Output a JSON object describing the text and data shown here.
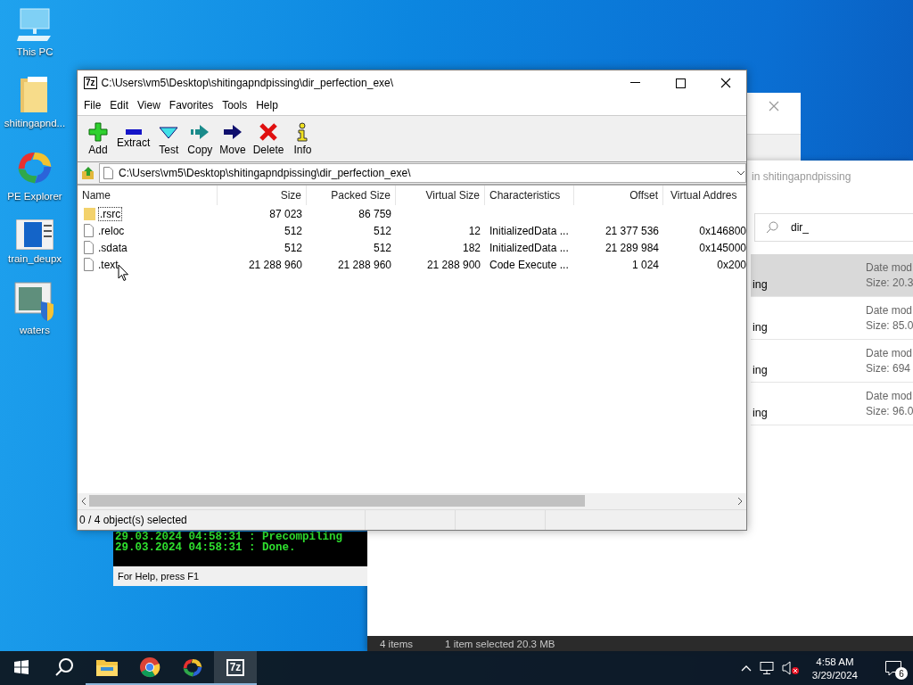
{
  "desktop_icons": [
    {
      "label": "This PC",
      "kind": "pc"
    },
    {
      "label": "shitingapnd...",
      "kind": "folder"
    },
    {
      "label": "PE Explorer",
      "kind": "pe"
    },
    {
      "label": "train_deupx",
      "kind": "window"
    },
    {
      "label": "waters",
      "kind": "installer"
    }
  ],
  "explorer_window": {
    "location": "in shitingapndpissing",
    "search_value": "dir_",
    "results": [
      {
        "name": "ing",
        "date": "Date mod",
        "size": "Size: 20.3",
        "selected": true
      },
      {
        "name": "ing",
        "date": "Date mod",
        "size": "Size: 85.0",
        "selected": false
      },
      {
        "name": "ing",
        "date": "Date mod",
        "size": "Size: 694",
        "selected": false
      },
      {
        "name": "ing",
        "date": "Date mod",
        "size": "Size: 96.0",
        "selected": false
      }
    ],
    "status_bar": [
      "4 items",
      "1 item selected  20.3 MB"
    ]
  },
  "console_window": {
    "lines": [
      "29.03.2024 04:58:31 : Precompiling",
      "29.03.2024 04:58:31 : Done."
    ],
    "status": "For Help, press F1"
  },
  "archive_window": {
    "icon_label": "7z",
    "title": "C:\\Users\\vm5\\Desktop\\shitingapndpissing\\dir_perfection_exe\\",
    "menu": [
      "File",
      "Edit",
      "View",
      "Favorites",
      "Tools",
      "Help"
    ],
    "toolbar": [
      {
        "label": "Add",
        "kind": "add"
      },
      {
        "label": "Extract",
        "kind": "extract"
      },
      {
        "label": "Test",
        "kind": "test"
      },
      {
        "label": "Copy",
        "kind": "copy"
      },
      {
        "label": "Move",
        "kind": "move"
      },
      {
        "label": "Delete",
        "kind": "delete"
      },
      {
        "label": "Info",
        "kind": "info"
      }
    ],
    "address": "C:\\Users\\vm5\\Desktop\\shitingapndpissing\\dir_perfection_exe\\",
    "columns": [
      "Name",
      "Size",
      "Packed Size",
      "Virtual Size",
      "Characteristics",
      "Offset",
      "Virtual Addres"
    ],
    "rows": [
      {
        "kind": "folder",
        "focused": true,
        "cells": [
          ".rsrc",
          "87 023",
          "86 759",
          "",
          "",
          "",
          ""
        ]
      },
      {
        "kind": "file",
        "focused": false,
        "cells": [
          ".reloc",
          "512",
          "512",
          "12",
          "InitializedData ...",
          "21 377 536",
          "0x146800"
        ]
      },
      {
        "kind": "file",
        "focused": false,
        "cells": [
          ".sdata",
          "512",
          "512",
          "182",
          "InitializedData ...",
          "21 289 984",
          "0x145000"
        ]
      },
      {
        "kind": "file",
        "focused": false,
        "cells": [
          ".text",
          "21 288 960",
          "21 288 960",
          "21 288 900",
          "Code Execute ...",
          "1 024",
          "0x200"
        ]
      }
    ],
    "status": "0 / 4 object(s) selected"
  },
  "taskbar": {
    "apps": [
      {
        "kind": "start",
        "running": false,
        "active": false
      },
      {
        "kind": "search",
        "running": false,
        "active": false
      },
      {
        "kind": "explorer",
        "running": true,
        "active": false
      },
      {
        "kind": "chrome",
        "running": true,
        "active": false
      },
      {
        "kind": "pe",
        "running": true,
        "active": false
      },
      {
        "kind": "archiver",
        "label": "7z",
        "running": true,
        "active": true
      }
    ],
    "time": "4:58 AM",
    "date": "3/29/2024",
    "notifications": "6"
  }
}
